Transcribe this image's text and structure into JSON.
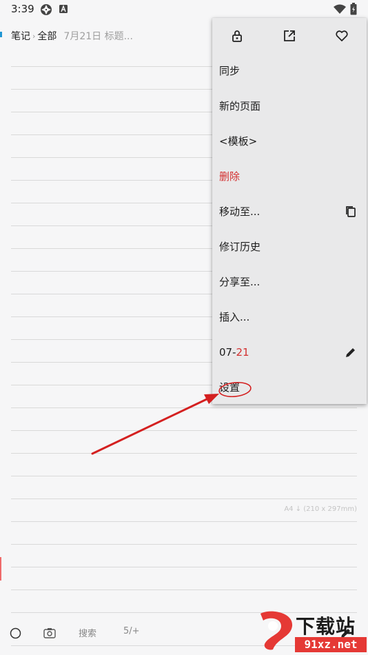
{
  "status_bar": {
    "time": "3:39"
  },
  "breadcrumb": {
    "notebook": "笔记",
    "separator": "›",
    "section": "全部",
    "page_title": "7月21日 标题..."
  },
  "page": {
    "paper_size": "A4 ↓ (210 x 297mm)"
  },
  "bottom_bar": {
    "search_label": "搜索",
    "page_counter": "5/+"
  },
  "menu": {
    "icons": [
      "lock-icon",
      "open-external-icon",
      "heart-icon"
    ],
    "items": [
      {
        "label": "同步"
      },
      {
        "label": "新的页面"
      },
      {
        "label": "<模板>"
      },
      {
        "label": "删除",
        "color": "#d32f2f"
      },
      {
        "label": "移动至...",
        "trailing_icon": "copy-icon"
      },
      {
        "label": "修订历史"
      },
      {
        "label": "分享至..."
      },
      {
        "label": "插入..."
      },
      {
        "label_prefix": "07-",
        "label_highlight": "21",
        "trailing_icon": "pencil-icon"
      },
      {
        "label": "设置"
      }
    ]
  },
  "colors": {
    "accent": "#2196d3",
    "danger": "#d32f2f",
    "annotation": "#d42020"
  },
  "watermark": {
    "title": "下载站",
    "url": "91xz.net"
  }
}
